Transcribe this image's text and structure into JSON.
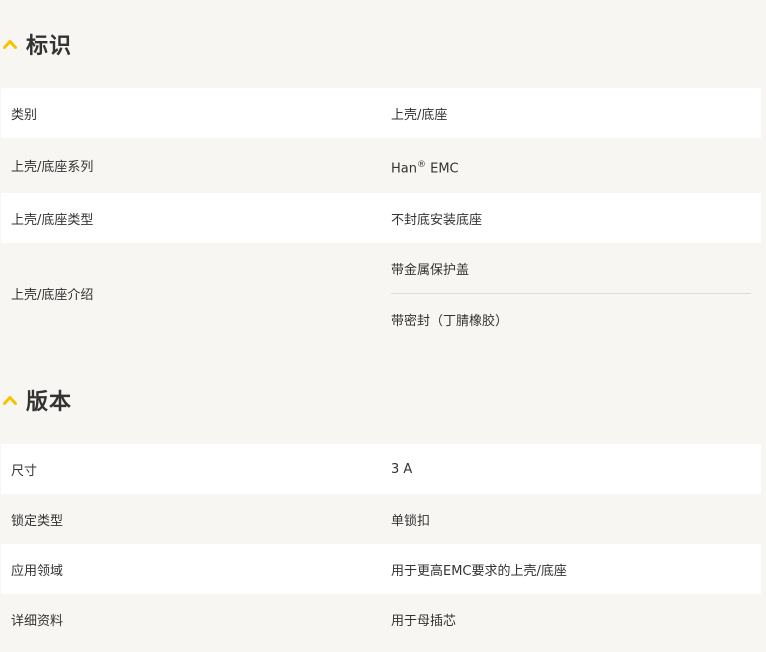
{
  "sections": [
    {
      "title": "标识",
      "rows": [
        {
          "label": "类别",
          "value": "上壳/底座"
        },
        {
          "label": "上壳/底座系列",
          "value": "Han",
          "value_sup": "®",
          "value_suffix": " EMC"
        },
        {
          "label": "上壳/底座类型",
          "value": "不封底安装底座"
        },
        {
          "label": "上壳/底座介绍",
          "values": [
            "带金属保护盖",
            "带密封（丁腈橡胶）"
          ]
        }
      ]
    },
    {
      "title": "版本",
      "rows": [
        {
          "label": "尺寸",
          "value": "3 A"
        },
        {
          "label": "锁定类型",
          "value": "单锁扣"
        },
        {
          "label": "应用领域",
          "value": "用于更高EMC要求的上壳/底座"
        },
        {
          "label": "详细资料",
          "value": "用于母插芯"
        }
      ]
    }
  ],
  "icons": {
    "collapse": "chevron-up-icon"
  },
  "colors": {
    "accent": "#f5c400",
    "row_alt": "#f7f6f3",
    "row": "#ffffff"
  }
}
